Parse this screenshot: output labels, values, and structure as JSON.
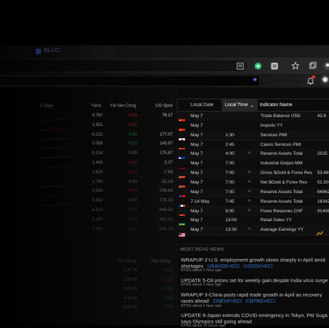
{
  "browser": {
    "tab_title": "BLOO",
    "bookmark_star": "★"
  },
  "left_table": {
    "headers": [
      "2 Days",
      "Yield",
      "Yld Net Chng",
      "US Sprd"
    ],
    "rows": [
      {
        "yield": "0.767",
        "chg": "-0.03",
        "sprd": "78.17",
        "dir": "down"
      },
      {
        "yield": "1.551",
        "chg": "-0.01",
        "sprd": "",
        "dir": "down"
      },
      {
        "yield": "-0.221",
        "chg": "0.01",
        "sprd": "177.07",
        "dir": "up"
      },
      {
        "yield": "0.089",
        "chg": "0.01",
        "sprd": "145.97",
        "dir": "up"
      },
      {
        "yield": "-0.214",
        "chg": "0.00",
        "sprd": "175.87",
        "dir": "flat"
      },
      {
        "yield": "1.498",
        "chg": "-0.02",
        "sprd": "5.07",
        "dir": "down"
      },
      {
        "yield": "1.625",
        "chg": "-0.01",
        "sprd": "-7.63",
        "dir": "down"
      },
      {
        "yield": "1.765",
        "chg": "0.00",
        "sprd": "-21.13",
        "dir": "flat"
      },
      {
        "yield": "9.345",
        "chg": "-0.04",
        "sprd": "-749.63",
        "dir": "down"
      },
      {
        "yield": "8.832",
        "chg": "0.00",
        "sprd": "-778.13",
        "dir": "flat"
      },
      {
        "yield": "6.012",
        "chg": "0.14",
        "sprd": "-446.53",
        "dir": "up"
      },
      {
        "yield": "3.167",
        "chg": "0.03",
        "sprd": "-161.23",
        "dir": "up"
      },
      {
        "yield": "7.040",
        "chg": "0.02",
        "sprd": "-545.13",
        "dir": "up"
      }
    ],
    "lower_headers": [
      "Pct Chng",
      "Net Chng"
    ],
    "lower_rows": [
      {
        "pct": "1.37 %",
        "net": "0.21"
      },
      {
        "pct": "1.00 %",
        "net": "-0.01"
      },
      {
        "pct": "0.23 %",
        "net": "0.01"
      },
      {
        "pct": "0.04 %",
        "net": "0.04"
      },
      {
        "pct": "0.03 %",
        "net": "0.00"
      }
    ]
  },
  "calendar": {
    "headers": {
      "date": "Local Date",
      "time": "Local Time",
      "indicator": "Indicator Name"
    },
    "sort_icon": "▲",
    "rows": [
      {
        "flag": "cn",
        "date": "May 7",
        "time": "",
        "approx": false,
        "indicator": "Trade Balance USD",
        "value": "42.8"
      },
      {
        "flag": "cn",
        "date": "May 7",
        "time": "",
        "approx": false,
        "indicator": "Imports YY",
        "value": ""
      },
      {
        "flag": "jp",
        "date": "May 7",
        "time": "1:30",
        "approx": false,
        "indicator": "Services PMI",
        "value": ""
      },
      {
        "flag": "cn",
        "date": "May 7",
        "time": "2:45",
        "approx": false,
        "indicator": "Caixin Services PMI",
        "value": ""
      },
      {
        "flag": "ph",
        "date": "May 7",
        "time": "4:00",
        "approx": true,
        "indicator": "Reserve Assets Total",
        "value": "2015"
      },
      {
        "flag": "de",
        "date": "May 7",
        "time": "7:00",
        "approx": false,
        "indicator": "Industrial Output MM",
        "value": ""
      },
      {
        "flag": "za",
        "date": "May 7",
        "time": "7:00",
        "approx": true,
        "indicator": "Gross $Gold & Forex Res",
        "value": "53.68"
      },
      {
        "flag": "za",
        "date": "May 7",
        "time": "7:00",
        "approx": true,
        "indicator": "Net $Gold & Forex Res",
        "value": "51.50"
      },
      {
        "flag": "tw",
        "date": "May 7",
        "time": "7:00",
        "approx": true,
        "indicator": "Reserve Assets Total",
        "value": "66662"
      },
      {
        "flag": "fr",
        "date": "7-14 May",
        "time": "7:45",
        "approx": true,
        "indicator": "Reserve Assets Total",
        "value": "18342"
      },
      {
        "flag": "ch",
        "date": "May 7",
        "time": "8:00",
        "approx": true,
        "indicator": "Forex Reserves CHF",
        "value": "91408"
      },
      {
        "flag": "br",
        "date": "May 7",
        "time": "13:00",
        "approx": false,
        "indicator": "Retail Sales YY",
        "value": ""
      },
      {
        "flag": "us",
        "date": "May 7",
        "time": "13:30",
        "approx": true,
        "indicator": "Average Earnings YY",
        "value": ""
      }
    ]
  },
  "news": {
    "header": "MOST READ NEWS",
    "items": [
      {
        "title": "WRAPUP 2-U.S. employment growth slows sharply in April amid shortages",
        "links": [
          "USAVGE=ECI",
          "USSOV=ECI"
        ],
        "meta": "RTRS   about 1 hour ago"
      },
      {
        "title": "UPDATE 5-Oil prices set for weekly gain despite India virus surge",
        "links": [],
        "meta": "RTRS   about 1 hour ago"
      },
      {
        "title": "WRAPUP 3-China posts rapid trade growth in April as recovery races ahead",
        "links": [
          "CNEXP=ECI",
          "CNTRD=ECI"
        ],
        "meta": "RTRS   about 1 hour ago"
      },
      {
        "title": "UPDATE 9-Japan extends COVID emergency in Tokyo, PM Suga says Olympics still going ahead",
        "links": [],
        "meta": "RTRS   about 10 hours ago"
      }
    ]
  }
}
